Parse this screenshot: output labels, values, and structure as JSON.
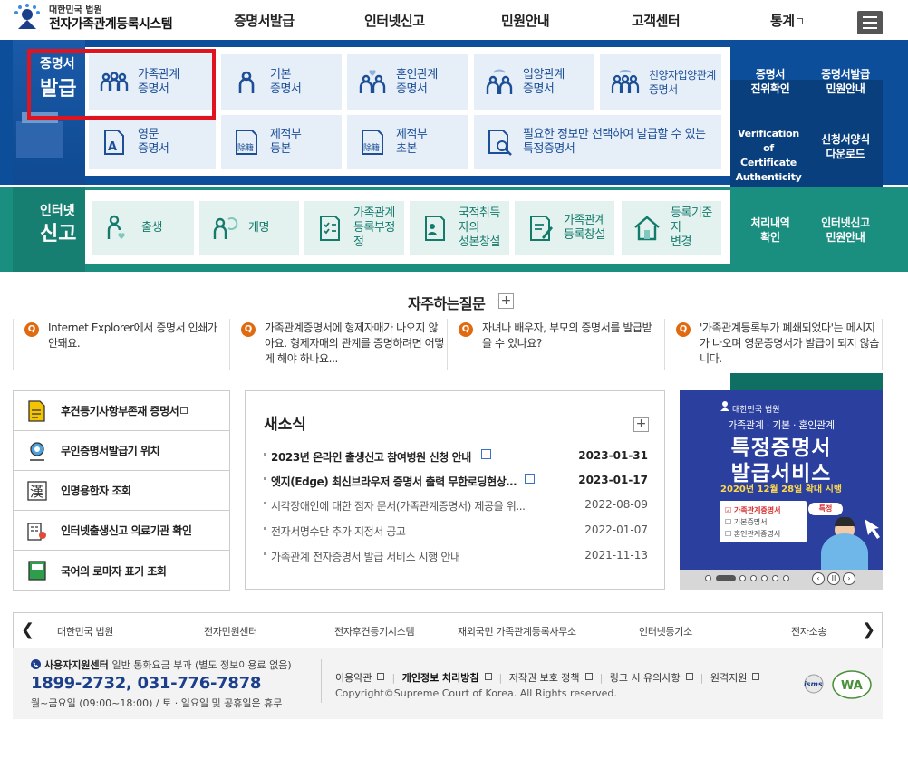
{
  "header": {
    "logo_small": "대한민국 법원",
    "logo_big": "전자가족관계등록시스템",
    "nav": [
      "증명서발급",
      "인터넷신고",
      "민원안내",
      "고객센터",
      "통계"
    ]
  },
  "cert": {
    "title_small": "증명서",
    "title_large": "발급",
    "tiles": [
      "가족관계\n증명서",
      "기본\n증명서",
      "혼인관계\n증명서",
      "입양관계\n증명서",
      "친양자입양관계\n증명서",
      "영문\n증명서",
      "제적부\n등본",
      "제적부\n초본",
      "필요한 정보만 선택하여 발급할 수 있는\n특정증명서"
    ],
    "side_links": [
      "증명서\n진위확인",
      "증명서발급\n민원안내",
      "Verification of\nCertificate\nAuthenticity",
      "신청서양식\n다운로드"
    ],
    "stamp_text": "除籍"
  },
  "net": {
    "title_small": "인터넷",
    "title_large": "신고",
    "tiles": [
      "출생",
      "개명",
      "가족관계\n등록부정정",
      "국적취득자의\n성본창설",
      "가족관계\n등록창설",
      "등록기준지\n변경"
    ],
    "side_links": [
      "처리내역\n확인",
      "인터넷신고\n민원안내"
    ]
  },
  "faq": {
    "title": "자주하는질문",
    "plus": "+",
    "q_mark": "Q",
    "items": [
      "Internet Explorer에서 증명서 인쇄가 안돼요.",
      "가족관계증명서에 형제자매가 나오지 않아요. 형제자매의 관계를 증명하려면 어떻게 해야 하나요...",
      "자녀나 배우자, 부모의 증명서를 발급받을 수 있나요?",
      "'가족관계등록부가 폐쇄되었다'는 메시지가 나오며 영문증명서가 발급이 되지 않습니다."
    ]
  },
  "quick_links": [
    "후견등기사항부존재 증명서",
    "무인증명서발급기 위치",
    "인명용한자 조회",
    "인터넷출생신고 의료기관 확인",
    "국어의 로마자 표기 조회"
  ],
  "quick_hanja": "漢",
  "news": {
    "title": "새소식",
    "plus": "+",
    "items": [
      {
        "text": "2023년 온라인 출생신고 참여병원 신청 안내",
        "date": "2023-01-31"
      },
      {
        "text": "엣지(Edge) 최신브라우저 증명서 출력 무한로딩현상 ...",
        "date": "2023-01-17"
      },
      {
        "text": "시각장애인에 대한 점자 문서(가족관계증명서) 제공을 위...",
        "date": "2022-08-09"
      },
      {
        "text": "전자서명수단 추가 지정서 공고",
        "date": "2022-01-07"
      },
      {
        "text": "가족관계 전자증명서 발급 서비스 시행 안내",
        "date": "2021-11-13"
      }
    ]
  },
  "banner": {
    "small": "대한민국 법원",
    "sub": "가족관계 · 기본 · 혼인관계",
    "line1": "특정증명서",
    "line2": "발급서비스",
    "date": "2020년 12월 28일 확대 시행",
    "card": [
      "가족관계증명서",
      "기본증명서",
      "혼인관계증명서"
    ],
    "card_check": "☑",
    "card_box": "☐",
    "tag": "특정",
    "prev": "‹",
    "pause": "II",
    "next": "›"
  },
  "family_sites": [
    "대한민국 법원",
    "전자민원센터",
    "전자후견등기시스템",
    "재외국민 가족관계등록사무소",
    "인터넷등기소",
    "전자소송"
  ],
  "family_prev": "❮",
  "family_next": "❯",
  "footer": {
    "center_label": "사용자지원센터",
    "center_note": "일반 통화요금 부과 (별도 정보이용료 없음)",
    "phone": "1899-2732, 031-776-7878",
    "hours": "월~금요일 (09:00~18:00) / 토 · 일요일 및 공휴일은 휴무",
    "links": [
      "이용약관",
      "개인정보 처리방침",
      "저작권 보호 정책",
      "링크 시 유의사항",
      "원격지원"
    ],
    "copyright": "Copyright©Supreme Court of Korea. All Rights reserved.",
    "isms": "isms",
    "wa": "WA"
  },
  "colors": {
    "cert_blue": "#0d4e9a",
    "net_teal": "#1a8f80",
    "highlight": "#e0141e",
    "tile_text": "#1c4f98"
  }
}
